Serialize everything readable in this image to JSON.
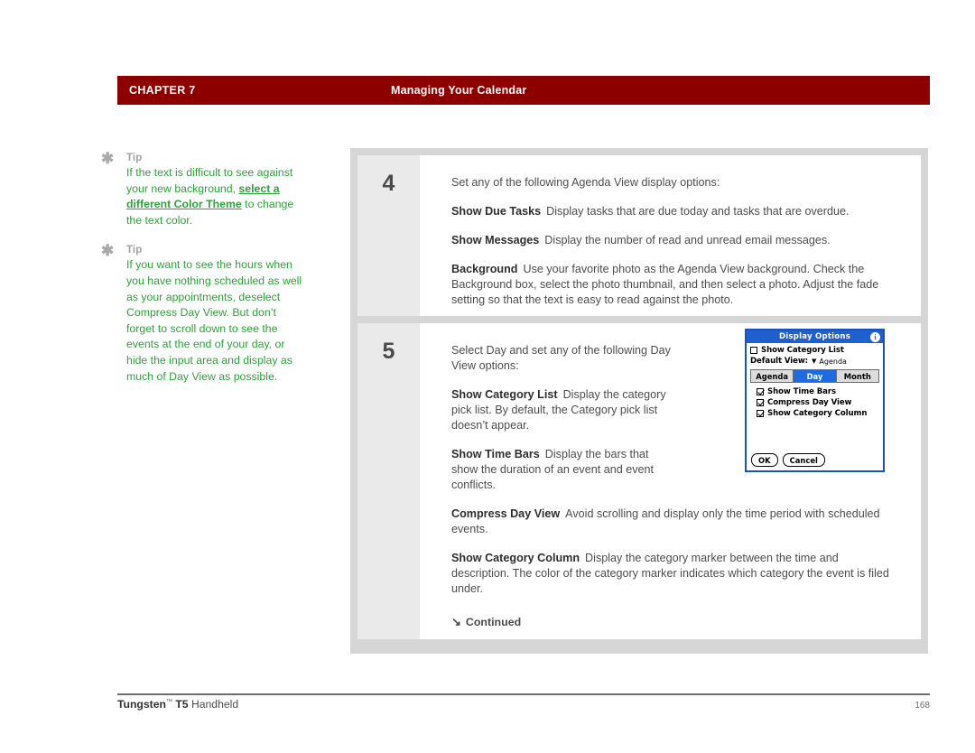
{
  "header": {
    "chapter": "CHAPTER 7",
    "section": "Managing Your Calendar",
    "bar_color": "#8c0000"
  },
  "sidebar": {
    "tips": [
      {
        "label": "Tip",
        "text_before": "If the text is difficult to see against your new background, ",
        "link_text": "select a different Color Theme",
        "text_after": " to change the text color."
      },
      {
        "label": "Tip",
        "text_before": "If you want to see the hours when you have nothing scheduled as well as your appointments, deselect Compress Day View. But don’t forget to scroll down to see the events at the end of your day, or hide the input area and display as much of Day View as possible.",
        "link_text": "",
        "text_after": ""
      }
    ],
    "tip_color": "#2fa03a",
    "label_color": "#a2a2a2"
  },
  "steps": [
    {
      "number": "4",
      "intro": "Set any of the following Agenda View display options:",
      "items": [
        {
          "term": "Show Due Tasks",
          "desc": "Display tasks that are due today and tasks that are overdue."
        },
        {
          "term": "Show Messages",
          "desc": "Display the number of read and unread email messages."
        },
        {
          "term": "Background",
          "desc": "Use your favorite photo as the Agenda View background. Check the Background box, select the photo thumbnail, and then select a photo. Adjust the fade setting so that the text is easy to read against the photo."
        }
      ]
    },
    {
      "number": "5",
      "intro": "Select Day and set any of the following Day View options:",
      "items": [
        {
          "term": "Show Category List",
          "desc": "Display the category pick list. By default, the Category pick list doesn’t appear."
        },
        {
          "term": "Show Time Bars",
          "desc": "Display the bars that show the duration of an event and event conflicts."
        },
        {
          "term": "Compress Day View",
          "desc": "Avoid scrolling and display only the time period with scheduled events."
        },
        {
          "term": "Show Category Column",
          "desc": "Display the category marker between the time and description. The color of the category marker indicates which category the event is filed under."
        }
      ],
      "continued_label": "Continued",
      "continued_arrow": "↘"
    }
  ],
  "pda_dialog": {
    "title": "Display Options",
    "info_icon": "i",
    "title_bar_color": "#1f5fd0",
    "show_category_list": {
      "label": "Show Category List",
      "checked": false
    },
    "default_view": {
      "label": "Default View:",
      "triangle": "▼",
      "value": "Agenda"
    },
    "tabs": [
      {
        "label": "Agenda",
        "active": false
      },
      {
        "label": "Day",
        "active": true
      },
      {
        "label": "Month",
        "active": false
      }
    ],
    "checkboxes": [
      {
        "label": "Show Time Bars",
        "checked": true
      },
      {
        "label": "Compress Day View",
        "checked": true
      },
      {
        "label": "Show Category Column",
        "checked": true
      }
    ],
    "buttons": [
      {
        "label": "OK"
      },
      {
        "label": "Cancel"
      }
    ]
  },
  "footer": {
    "product_name": "Tungsten",
    "trademark": "™",
    "model": "T5",
    "suffix": "Handheld",
    "page_number": "168"
  }
}
